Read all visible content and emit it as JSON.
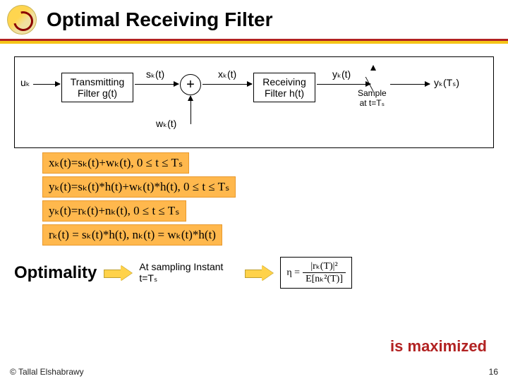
{
  "header": {
    "title": "Optimal Receiving Filter"
  },
  "diagram": {
    "input": "uₖ",
    "tx_label": "Transmitting\nFilter g(t)",
    "sk": "sₖ(t)",
    "plus": "+",
    "wk": "wₖ(t)",
    "xk": "xₖ(t)",
    "rx_label": "Receiving\nFilter h(t)",
    "yk": "yₖ(t)",
    "sample_label": "Sample\nat t=Tₛ",
    "ykt": "yₖ(Tₛ)"
  },
  "equations": {
    "e1": "xₖ(t)=sₖ(t)+wₖ(t), 0 ≤ t ≤ Tₛ",
    "e2": "yₖ(t)=sₖ(t)*h(t)+wₖ(t)*h(t), 0 ≤ t ≤ Tₛ",
    "e3": "yₖ(t)=rₖ(t)+nₖ(t), 0 ≤ t ≤ Tₛ",
    "e4": "rₖ(t) = sₖ(t)*h(t), nₖ(t) = wₖ(t)*h(t)"
  },
  "bottom": {
    "optimality": "Optimality",
    "at_sampling": "At sampling Instant t=Tₛ",
    "eta_prefix": "η =",
    "eta_num": "|rₖ(T)|²",
    "eta_den": "E[nₖ²(T)]",
    "is_max": "is maximized"
  },
  "footer": {
    "copyright": "© Tallal Elshabrawy",
    "page": "16"
  }
}
